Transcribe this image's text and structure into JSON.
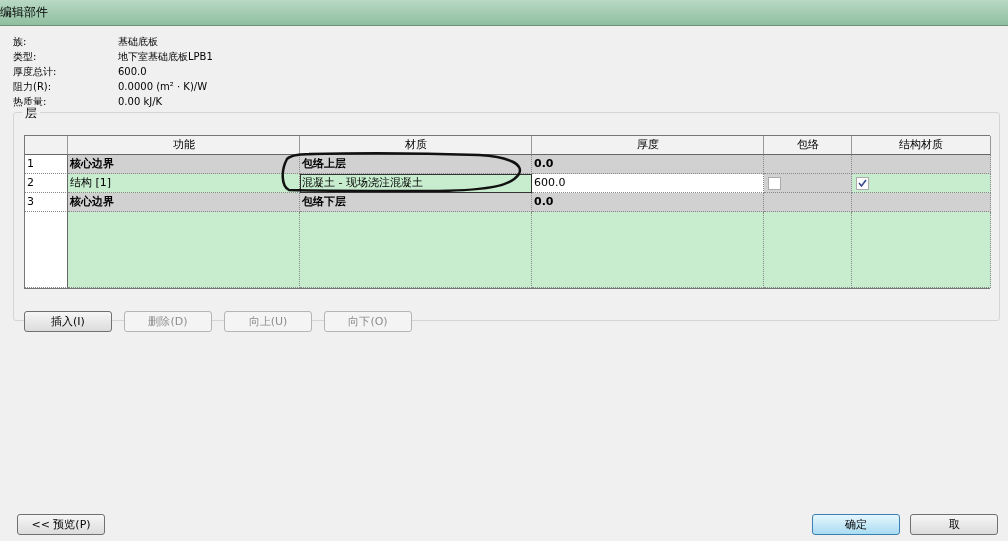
{
  "window": {
    "title": "编辑部件"
  },
  "properties": [
    {
      "label": "族:",
      "value": "基础底板"
    },
    {
      "label": "类型:",
      "value": "地下室基础底板LPB1"
    },
    {
      "label": "厚度总计:",
      "value": "600.0"
    },
    {
      "label": "阻力(R):",
      "value": "0.0000 (m² · K)/W"
    },
    {
      "label": "热质量:",
      "value": "0.00 kJ/K"
    }
  ],
  "layers": {
    "title": "层",
    "columns": [
      "功能",
      "材质",
      "厚度",
      "包络",
      "结构材质"
    ],
    "rows": [
      {
        "number": "1",
        "kind": "boundary",
        "function": "核心边界",
        "material": "包络上层",
        "thickness": "0.0"
      },
      {
        "number": "2",
        "kind": "layer",
        "function": "结构 [1]",
        "material": "混凝土 - 现场浇注混凝土",
        "thickness": "600.0",
        "wrap": false,
        "structural": true
      },
      {
        "number": "3",
        "kind": "boundary",
        "function": "核心边界",
        "material": "包络下层",
        "thickness": "0.0"
      }
    ],
    "buttons": [
      {
        "label": "插入(I)",
        "disabled": false
      },
      {
        "label": "删除(D)",
        "disabled": true
      },
      {
        "label": "向上(U)",
        "disabled": true
      },
      {
        "label": "向下(O)",
        "disabled": true
      }
    ]
  },
  "footer": {
    "preview": "<< 预览(P)",
    "ok": "确定",
    "cancel": "取"
  }
}
